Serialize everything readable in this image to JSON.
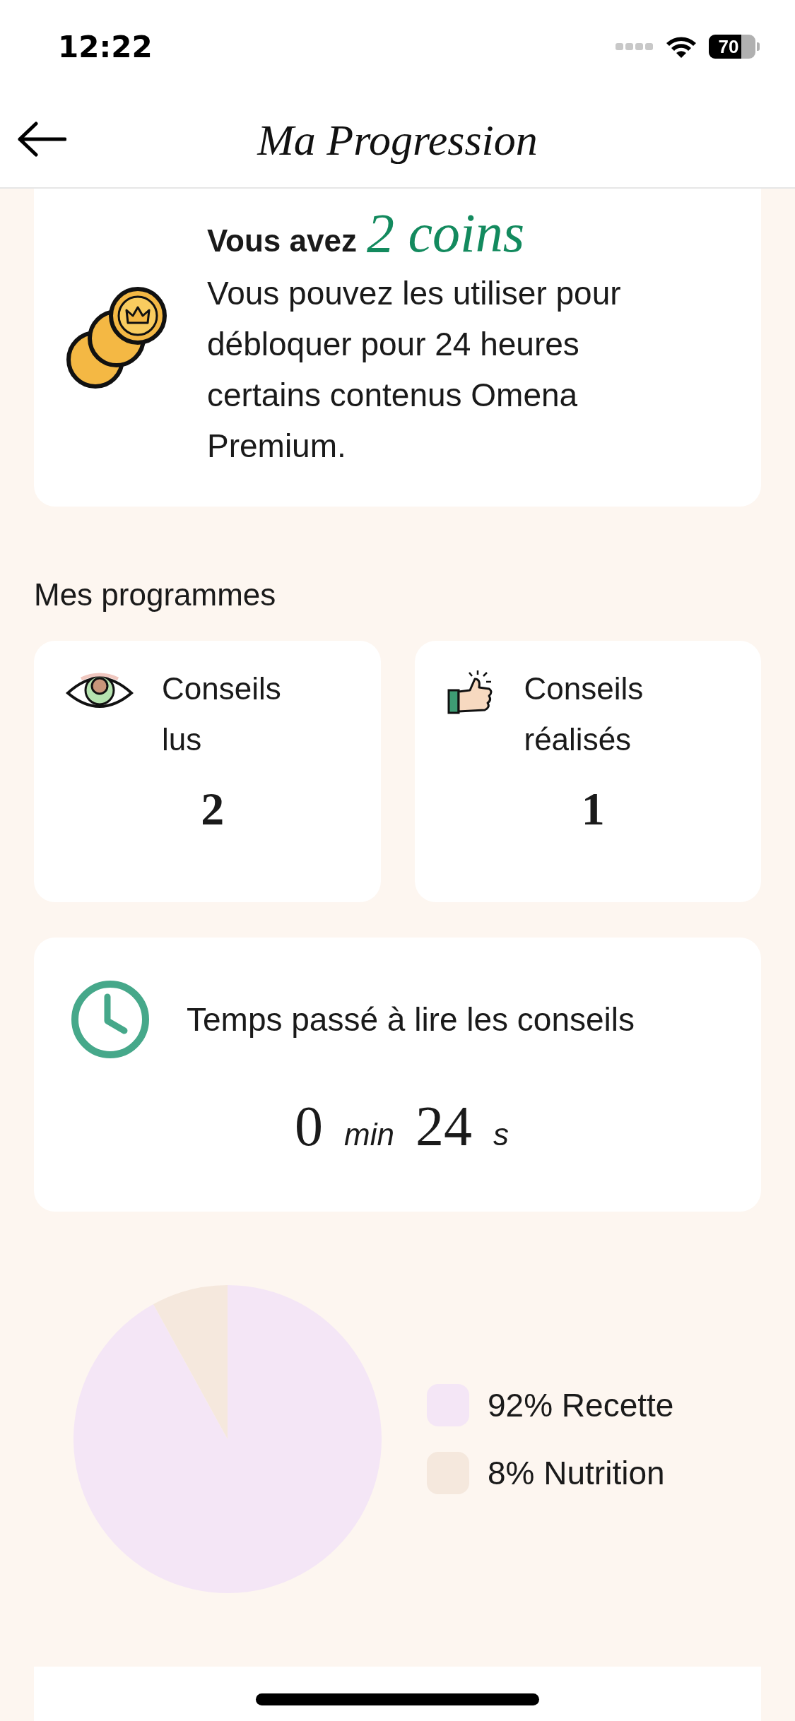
{
  "status_bar": {
    "time": "12:22",
    "battery": "70"
  },
  "header": {
    "title": "Ma Progression"
  },
  "coins_card": {
    "prefix": "Vous avez",
    "coins": "2 coins",
    "text": "Vous pouvez les utiliser pour débloquer pour 24 heures certains contenus Omena Premium."
  },
  "programs": {
    "title": "Mes programmes",
    "stats": [
      {
        "kind": "eye",
        "label": "Conseils lus",
        "value": "2"
      },
      {
        "kind": "thumb",
        "label": "Conseils réalisés",
        "value": "1"
      }
    ]
  },
  "time_card": {
    "label": "Temps passé à lire les conseils",
    "minutes": "0",
    "min_unit": "min",
    "seconds": "24",
    "sec_unit": "s"
  },
  "distribution": {
    "legend": [
      {
        "percent": "92%",
        "color": "#f4e6f6"
      },
      {
        "percent": "8%",
        "color": "#f5e8dd"
      }
    ],
    "chart_data": {
      "type": "pie",
      "categories": [
        "Recette",
        "Nutrition"
      ],
      "values": [
        92,
        8
      ]
    }
  }
}
